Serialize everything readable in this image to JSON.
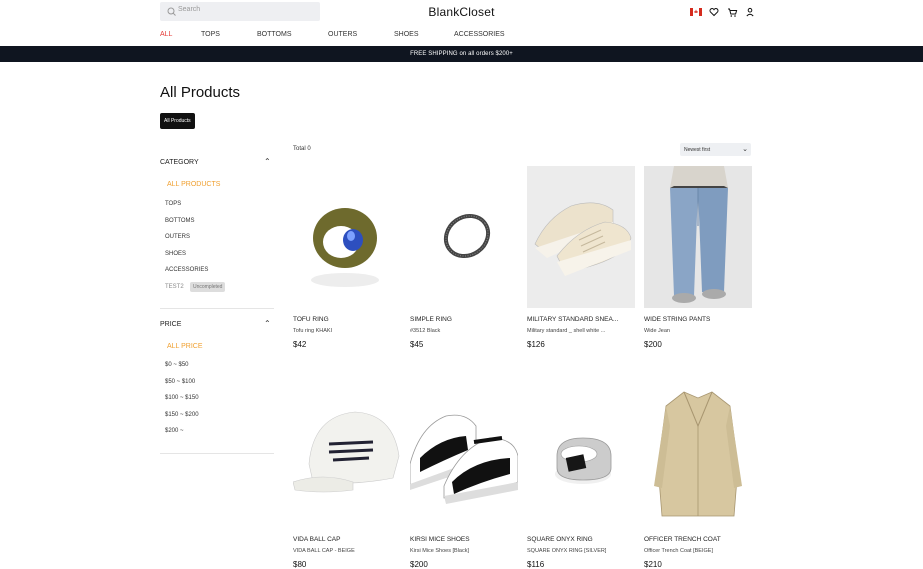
{
  "header": {
    "search_placeholder": "Search",
    "brand": "BlankCloset",
    "icons": [
      "canada-flag-icon",
      "heart-icon",
      "cart-icon",
      "user-icon"
    ]
  },
  "nav": {
    "items": [
      "ALL",
      "TOPS",
      "BOTTOMS",
      "OUTERS",
      "SHOES",
      "ACCESSORIES"
    ],
    "active": "ALL",
    "active_color": "#e53935"
  },
  "banner": {
    "text": "FREE SHIPPING on all orders $200+"
  },
  "page": {
    "title": "All Products",
    "crumb": "All Products",
    "total": "Total 0",
    "sort": "Newest first"
  },
  "sidebar": {
    "category_title": "CATEGORY",
    "categories": [
      "ALL PRODUCTS",
      "TOPS",
      "BOTTOMS",
      "OUTERS",
      "SHOES",
      "ACCESSORIES",
      "TEST2"
    ],
    "test2_badge": "Uncompleted",
    "price_title": "PRICE",
    "prices": [
      "ALL PRICE",
      "$0 ~ $50",
      "$50 ~ $100",
      "$100 ~ $150",
      "$150 ~ $200",
      "$200 ~"
    ],
    "active_color": "#f0a030"
  },
  "products": [
    {
      "name": "TOFU RING",
      "sub": "Tofu ring KHAKI",
      "price": "$42",
      "icon": "ring-icon"
    },
    {
      "name": "SIMPLE RING",
      "sub": "#3512 Black",
      "price": "$45",
      "icon": "ring-icon"
    },
    {
      "name": "MILITARY STANDARD SNEA...",
      "sub": "Military standard _ shell white ...",
      "price": "$126",
      "icon": "sneaker-icon"
    },
    {
      "name": "WIDE STRING PANTS",
      "sub": "Wide Jean",
      "price": "$200",
      "icon": "pants-icon"
    },
    {
      "name": "VIDA BALL CAP",
      "sub": "VIDA BALL CAP - BEIGE",
      "price": "$80",
      "icon": "cap-icon"
    },
    {
      "name": "KIRSI MICE SHOES",
      "sub": "Kirsi Mice Shoes [Black]",
      "price": "$200",
      "icon": "shoe-icon"
    },
    {
      "name": "SQUARE ONYX RING",
      "sub": "SQUARE ONYX RING [SILVER]",
      "price": "$116",
      "icon": "ring-icon"
    },
    {
      "name": "OFFICER TRENCH COAT",
      "sub": "Officer Trench Coat [BEIGE]",
      "price": "$210",
      "icon": "coat-icon"
    }
  ]
}
